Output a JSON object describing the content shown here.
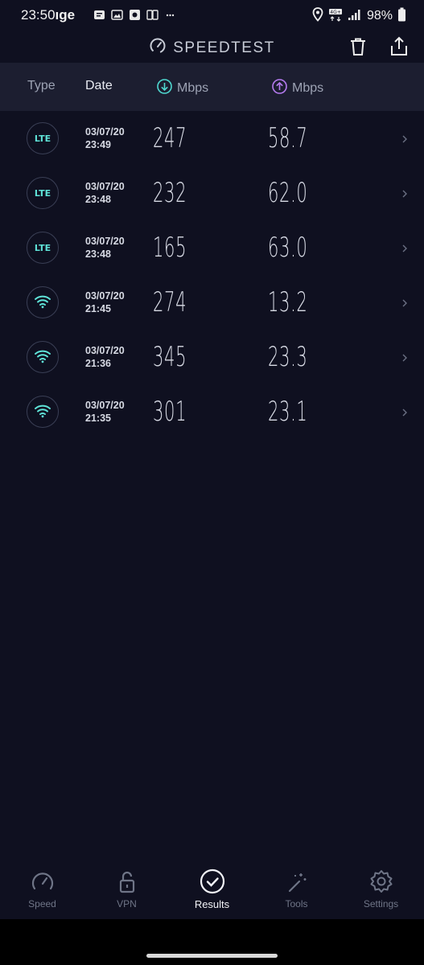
{
  "status_bar": {
    "time": "23:50",
    "time_suffix": "ıge",
    "battery": "98%",
    "network": "4G+"
  },
  "header": {
    "title": "SPEEDTEST",
    "icons": [
      "speedometer-icon",
      "trash-icon",
      "share-icon"
    ]
  },
  "columns": {
    "type": "Type",
    "date": "Date",
    "download": "Mbps",
    "upload": "Mbps"
  },
  "results": [
    {
      "type": "LTE",
      "date": "03/07/20",
      "time": "23:49",
      "download": "247",
      "upload": "58.7"
    },
    {
      "type": "LTE",
      "date": "03/07/20",
      "time": "23:48",
      "download": "232",
      "upload": "62.0"
    },
    {
      "type": "LTE",
      "date": "03/07/20",
      "time": "23:48",
      "download": "165",
      "upload": "63.0"
    },
    {
      "type": "wifi",
      "date": "03/07/20",
      "time": "21:45",
      "download": "274",
      "upload": "13.2"
    },
    {
      "type": "wifi",
      "date": "03/07/20",
      "time": "21:36",
      "download": "345",
      "upload": "23.3"
    },
    {
      "type": "wifi",
      "date": "03/07/20",
      "time": "21:35",
      "download": "301",
      "upload": "23.1"
    }
  ],
  "nav": {
    "speed": "Speed",
    "vpn": "VPN",
    "results": "Results",
    "tools": "Tools",
    "settings": "Settings",
    "active": "results"
  },
  "colors": {
    "background": "#0f1020",
    "header_bar": "#1c1e30",
    "download_accent": "#4fd8d0",
    "upload_accent": "#b57bf0",
    "lte_text": "#5fe3d8"
  }
}
